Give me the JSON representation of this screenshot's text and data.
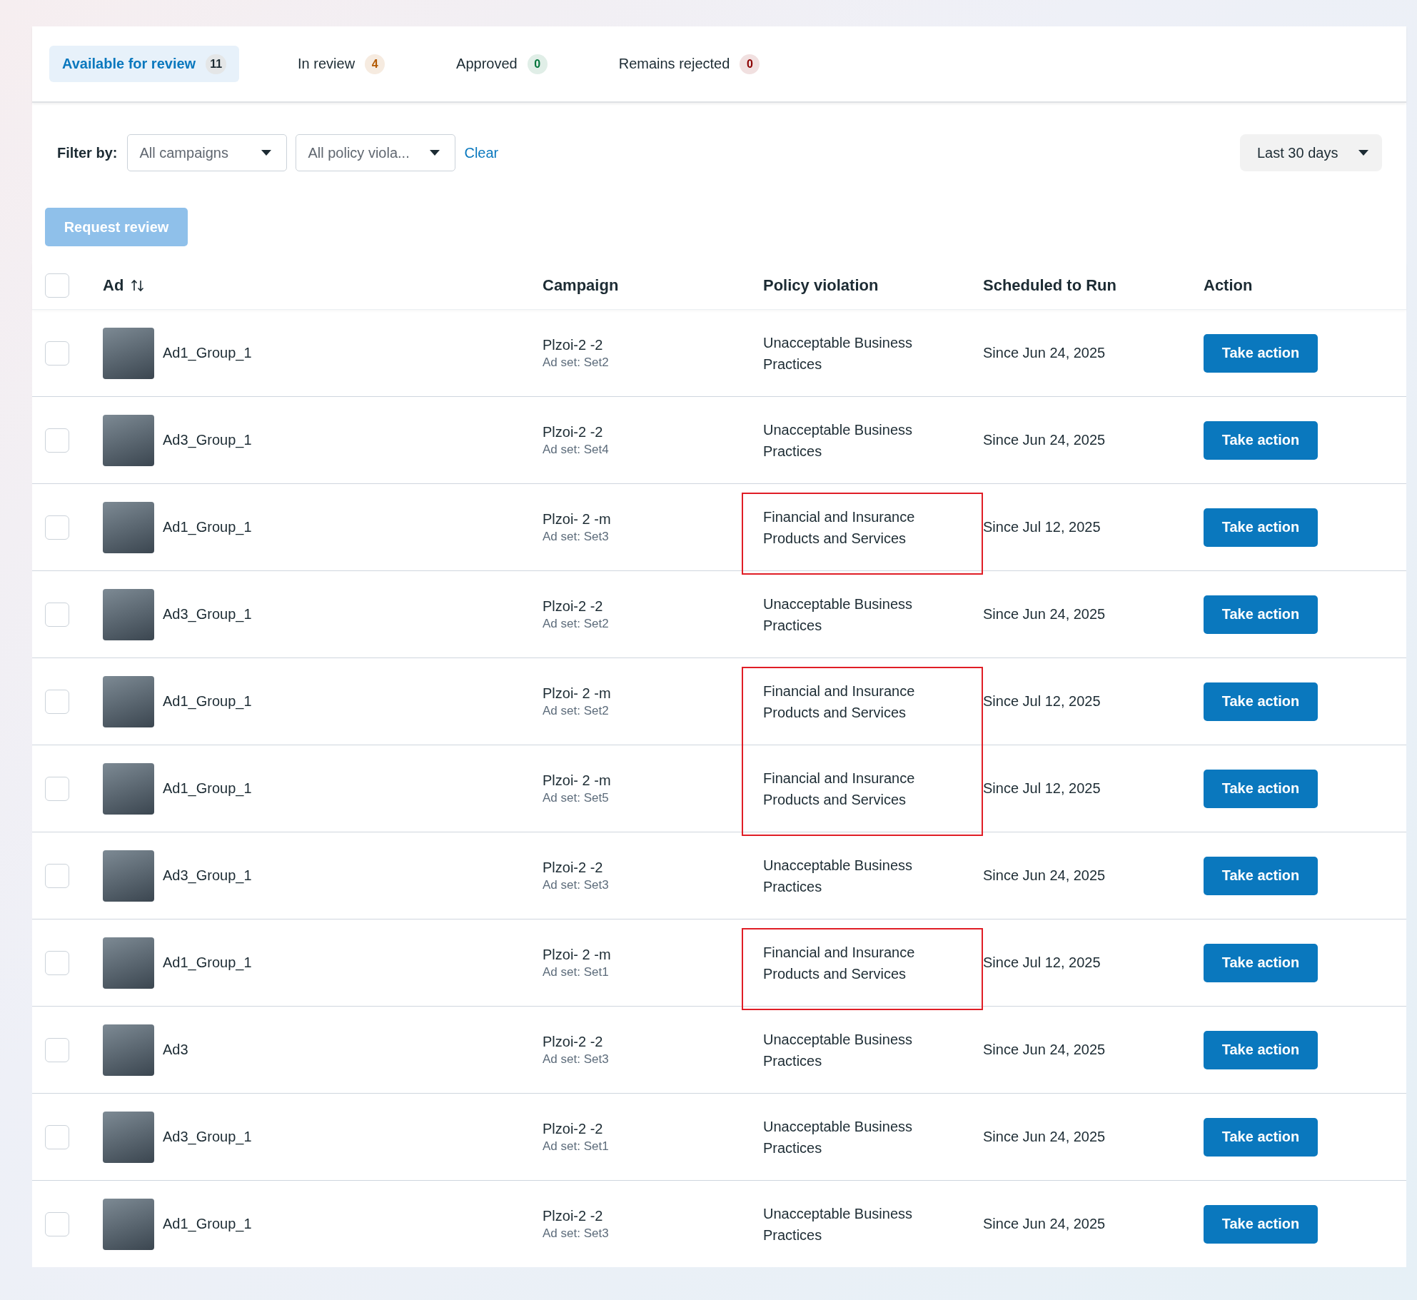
{
  "tabs": [
    {
      "label": "Available for review",
      "count": "11",
      "color": "#1c2b33",
      "selected": true
    },
    {
      "label": "In review",
      "count": "4",
      "color": "#b35900",
      "selected": false
    },
    {
      "label": "Approved",
      "count": "0",
      "color": "#00753b",
      "selected": false
    },
    {
      "label": "Remains rejected",
      "count": "0",
      "color": "#8c0000",
      "selected": false
    }
  ],
  "filters": {
    "label": "Filter by:",
    "dropdowns": [
      {
        "value": "All campaigns"
      },
      {
        "value": "All policy viola..."
      }
    ],
    "clear": "Clear",
    "date_range": "Last 30 days"
  },
  "request_review": {
    "label": "Request review",
    "disabled": true
  },
  "table": {
    "select_all_checked": false,
    "columns": [
      "Ad",
      "Campaign",
      "Policy violation",
      "Scheduled to Run",
      "Action"
    ],
    "rows": [
      {
        "checked": false,
        "ad": "Ad1_Group_1",
        "campaign": "Plzoi-2 -2",
        "ad_set": "Ad set: Set2",
        "policy": "Unacceptable Business Practices",
        "scheduled": "Since Jun 24, 2025",
        "action": "Take action",
        "highlighted": false
      },
      {
        "checked": false,
        "ad": "Ad3_Group_1",
        "campaign": "Plzoi-2 -2",
        "ad_set": "Ad set: Set4",
        "policy": "Unacceptable Business Practices",
        "scheduled": "Since Jun 24, 2025",
        "action": "Take action",
        "highlighted": false
      },
      {
        "checked": false,
        "ad": "Ad1_Group_1",
        "campaign": "Plzoi- 2 -m",
        "ad_set": "Ad set: Set3",
        "policy": "Financial and Insurance Products and Services",
        "scheduled": "Since Jul 12, 2025",
        "action": "Take action",
        "highlighted": true
      },
      {
        "checked": false,
        "ad": "Ad3_Group_1",
        "campaign": "Plzoi-2 -2",
        "ad_set": "Ad set: Set2",
        "policy": "Unacceptable Business Practices",
        "scheduled": "Since Jun 24, 2025",
        "action": "Take action",
        "highlighted": false
      },
      {
        "checked": false,
        "ad": "Ad1_Group_1",
        "campaign": "Plzoi- 2 -m",
        "ad_set": "Ad set: Set2",
        "policy": "Financial and Insurance Products and Services",
        "scheduled": "Since Jul 12, 2025",
        "action": "Take action",
        "highlighted": true
      },
      {
        "checked": false,
        "ad": "Ad1_Group_1",
        "campaign": "Plzoi- 2 -m",
        "ad_set": "Ad set: Set5",
        "policy": "Financial and Insurance Products and Services",
        "scheduled": "Since Jul 12, 2025",
        "action": "Take action",
        "highlighted": true
      },
      {
        "checked": false,
        "ad": "Ad3_Group_1",
        "campaign": "Plzoi-2 -2",
        "ad_set": "Ad set: Set3",
        "policy": "Unacceptable Business Practices",
        "scheduled": "Since Jun 24, 2025",
        "action": "Take action",
        "highlighted": false
      },
      {
        "checked": false,
        "ad": "Ad1_Group_1",
        "campaign": "Plzoi- 2 -m",
        "ad_set": "Ad set: Set1",
        "policy": "Financial and Insurance Products and Services",
        "scheduled": "Since Jul 12, 2025",
        "action": "Take action",
        "highlighted": true
      },
      {
        "checked": false,
        "ad": "Ad3",
        "campaign": "Plzoi-2 -2",
        "ad_set": "Ad set: Set3",
        "policy": "Unacceptable Business Practices",
        "scheduled": "Since Jun 24, 2025",
        "action": "Take action",
        "highlighted": false
      },
      {
        "checked": false,
        "ad": "Ad3_Group_1",
        "campaign": "Plzoi-2 -2",
        "ad_set": "Ad set: Set1",
        "policy": "Unacceptable Business Practices",
        "scheduled": "Since Jun 24, 2025",
        "action": "Take action",
        "highlighted": false
      },
      {
        "checked": false,
        "ad": "Ad1_Group_1",
        "campaign": "Plzoi-2 -2",
        "ad_set": "Ad set: Set3",
        "policy": "Unacceptable Business Practices",
        "scheduled": "Since Jun 24, 2025",
        "action": "Take action",
        "highlighted": false
      }
    ]
  }
}
